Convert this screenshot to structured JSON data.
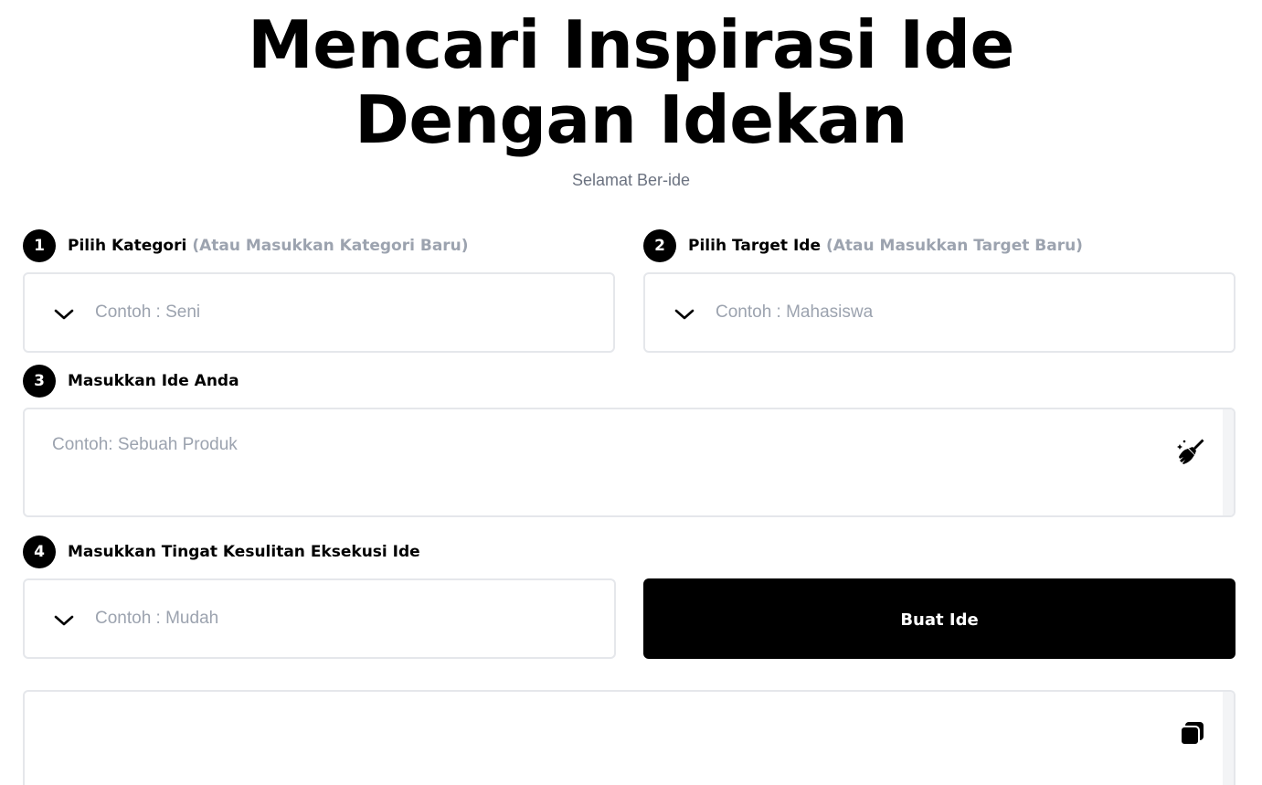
{
  "header": {
    "title_line1": "Mencari Inspirasi Ide",
    "title_line2": "Dengan Idekan",
    "subtitle": "Selamat Ber-ide"
  },
  "steps": [
    {
      "number": "1",
      "label": "Pilih Kategori",
      "hint": "(Atau Masukkan Kategori Baru)",
      "placeholder": "Contoh : Seni"
    },
    {
      "number": "2",
      "label": "Pilih Target Ide",
      "hint": "(Atau Masukkan Target Baru)",
      "placeholder": "Contoh : Mahasiswa"
    },
    {
      "number": "3",
      "label": "Masukkan Ide Anda",
      "placeholder": "Contoh: Sebuah Produk"
    },
    {
      "number": "4",
      "label": "Masukkan Tingat Kesulitan Eksekusi Ide",
      "placeholder": "Contoh : Mudah"
    }
  ],
  "actions": {
    "submit_label": "Buat Ide"
  },
  "icons": {
    "dropdown": "chevron-down-icon",
    "clear": "broom-icon",
    "copy": "copy-icon"
  },
  "colors": {
    "primary": "#000000",
    "hint": "#9ca3af",
    "subtitle": "#6b7280",
    "border": "#e5e7eb"
  }
}
